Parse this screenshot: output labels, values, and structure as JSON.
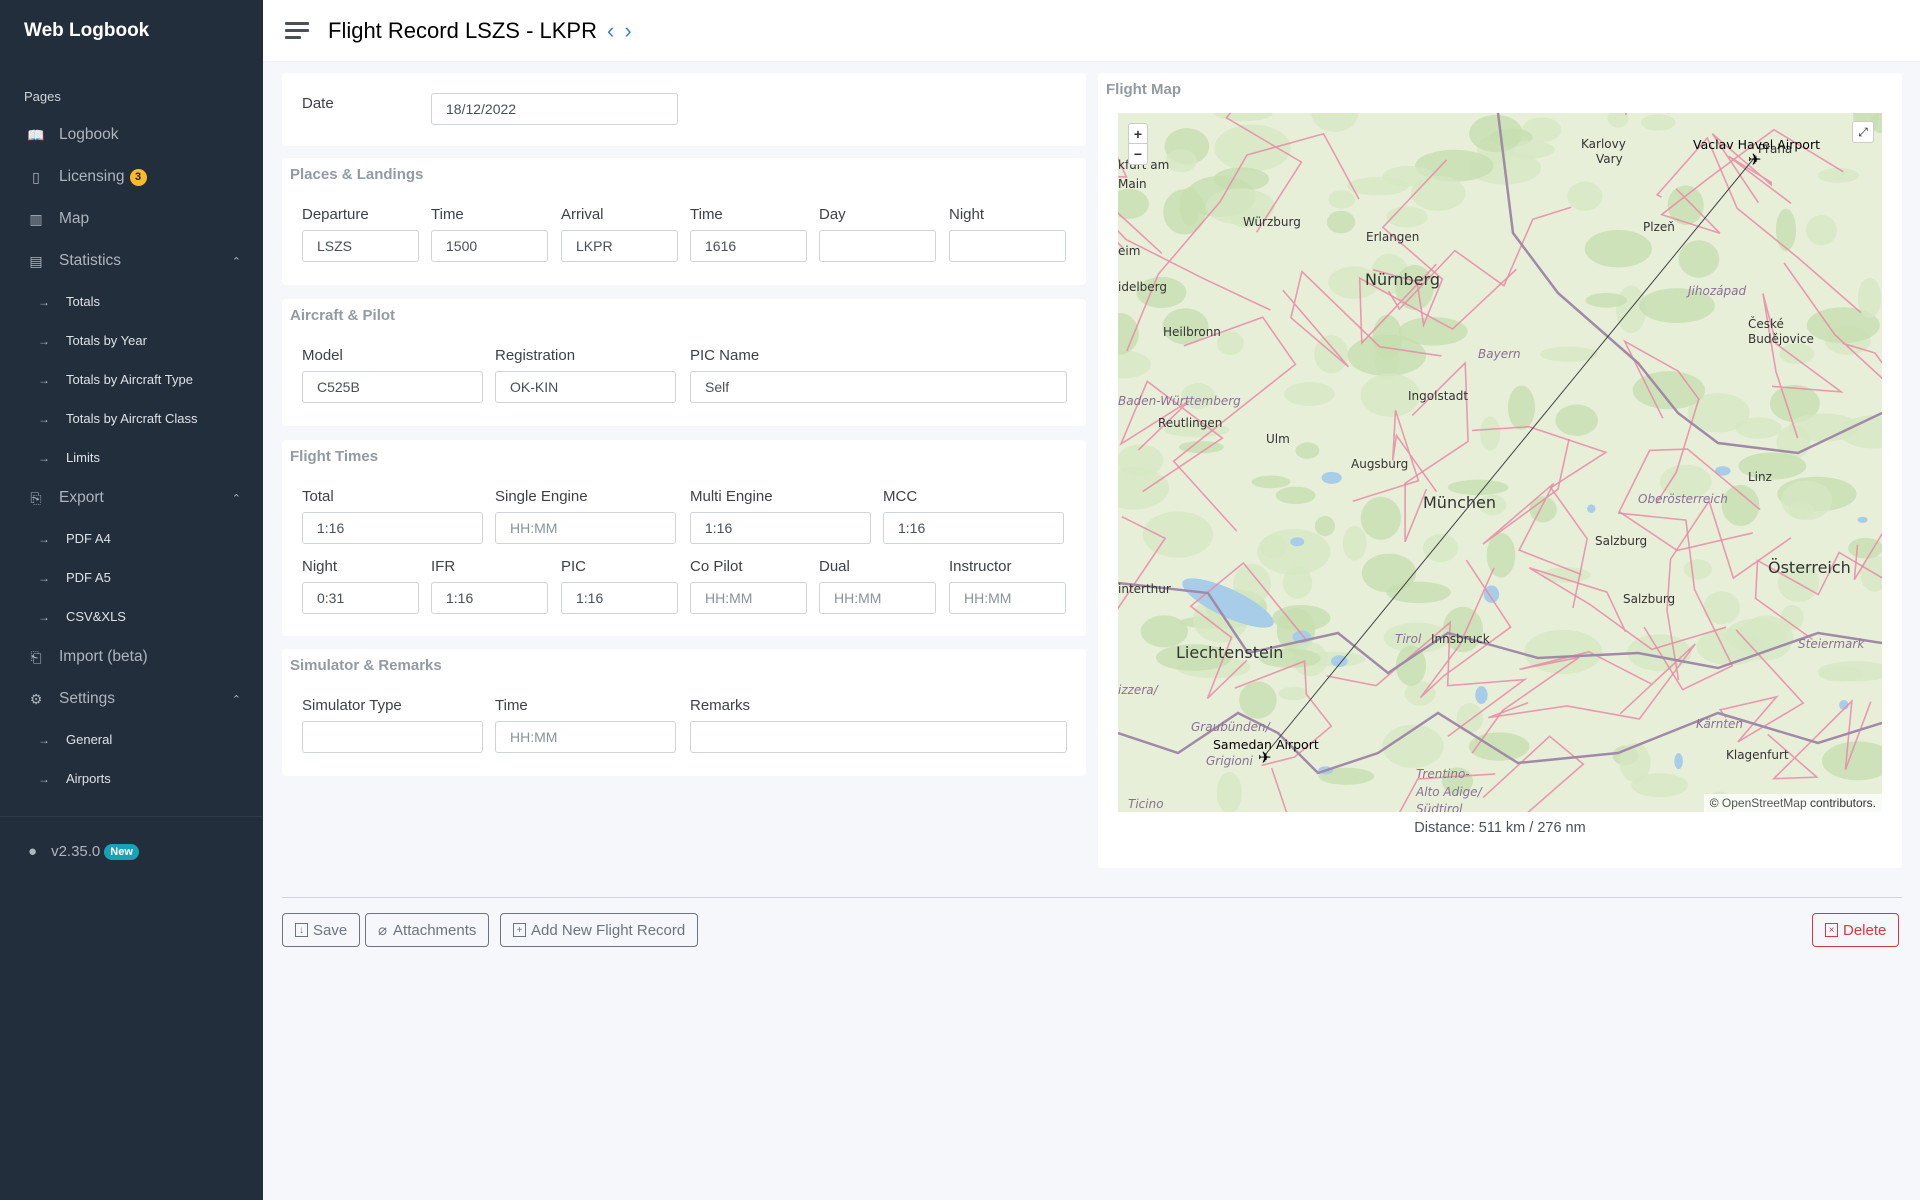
{
  "app": {
    "brand": "Web Logbook",
    "section": "Pages",
    "version": "v2.35.0",
    "version_badge": "New"
  },
  "sidebar": [
    {
      "type": "main",
      "label": "Logbook",
      "icon": "book-icon"
    },
    {
      "type": "main",
      "label": "Licensing",
      "icon": "id-card-icon",
      "badge": "3"
    },
    {
      "type": "main",
      "label": "Map",
      "icon": "map-icon"
    },
    {
      "type": "main",
      "label": "Statistics",
      "icon": "bar-chart-icon",
      "expanded": true
    },
    {
      "type": "sub",
      "label": "Totals"
    },
    {
      "type": "sub",
      "label": "Totals by Year"
    },
    {
      "type": "sub",
      "label": "Totals by Aircraft Type"
    },
    {
      "type": "sub",
      "label": "Totals by Aircraft Class"
    },
    {
      "type": "sub",
      "label": "Limits"
    },
    {
      "type": "main",
      "label": "Export",
      "icon": "file-download-icon",
      "expanded": true
    },
    {
      "type": "sub",
      "label": "PDF A4"
    },
    {
      "type": "sub",
      "label": "PDF A5"
    },
    {
      "type": "sub",
      "label": "CSV&XLS"
    },
    {
      "type": "main",
      "label": "Import (beta)",
      "icon": "file-upload-icon"
    },
    {
      "type": "main",
      "label": "Settings",
      "icon": "gear-icon",
      "expanded": true
    },
    {
      "type": "sub",
      "label": "General"
    },
    {
      "type": "sub",
      "label": "Airports"
    }
  ],
  "header": {
    "title": "Flight Record LSZS - LKPR"
  },
  "date": {
    "label": "Date",
    "value": "18/12/2022"
  },
  "places": {
    "title": "Places & Landings",
    "fields": [
      {
        "label": "Departure",
        "value": "LSZS"
      },
      {
        "label": "Time",
        "value": "1500"
      },
      {
        "label": "Arrival",
        "value": "LKPR"
      },
      {
        "label": "Time",
        "value": "1616"
      },
      {
        "label": "Day",
        "value": ""
      },
      {
        "label": "Night",
        "value": ""
      }
    ]
  },
  "aircraft": {
    "title": "Aircraft & Pilot",
    "fields": [
      {
        "label": "Model",
        "value": "C525B"
      },
      {
        "label": "Registration",
        "value": "OK-KIN"
      },
      {
        "label": "PIC Name",
        "value": "Self"
      }
    ]
  },
  "times": {
    "title": "Flight Times",
    "row1": [
      {
        "label": "Total",
        "value": "1:16"
      },
      {
        "label": "Single Engine",
        "value": "",
        "placeholder": "HH:MM"
      },
      {
        "label": "Multi Engine",
        "value": "1:16"
      },
      {
        "label": "MCC",
        "value": "1:16"
      }
    ],
    "row2": [
      {
        "label": "Night",
        "value": "0:31"
      },
      {
        "label": "IFR",
        "value": "1:16"
      },
      {
        "label": "PIC",
        "value": "1:16"
      },
      {
        "label": "Co Pilot",
        "value": "",
        "placeholder": "HH:MM"
      },
      {
        "label": "Dual",
        "value": "",
        "placeholder": "HH:MM"
      },
      {
        "label": "Instructor",
        "value": "",
        "placeholder": "HH:MM"
      }
    ]
  },
  "simulator": {
    "title": "Simulator & Remarks",
    "fields": [
      {
        "label": "Simulator Type",
        "value": ""
      },
      {
        "label": "Time",
        "value": "",
        "placeholder": "HH:MM"
      },
      {
        "label": "Remarks",
        "value": ""
      }
    ]
  },
  "map": {
    "title": "Flight Map",
    "zoom_in": "+",
    "zoom_out": "−",
    "fullscreen": "⤢",
    "attribution_link": "OpenStreetMap",
    "attribution_rest": "contributors.",
    "attribution_symbol": "©",
    "departure_airport": "Samedan Airport",
    "arrival_airport": "Vaclav Havel Airport",
    "labels": [
      "kfurt am",
      "Main",
      "Würzburg",
      "Erlangen",
      "Nürnberg",
      "Karlovy",
      "Vary",
      "Plzeň",
      "Jihozápad",
      "České",
      "Budějovice",
      "Bayern",
      "Ingolstadt",
      "Baden-Württemberg",
      "Reutlingen",
      "Ulm",
      "Augsburg",
      "München",
      "Linz",
      "Oberösterreich",
      "Salzburg",
      "Österreich",
      "Salzburg",
      "Tirol",
      "Innsbruck",
      "Liechtenstein",
      "Steiermark",
      "Graubünden/",
      "Grigioni",
      "Kärnten",
      "Klagenfurt",
      "Trentino-",
      "Alto Adige/",
      "Südtirol",
      "Ticino",
      "interthur",
      "eim",
      "idelberg",
      "Heilbronn",
      "izzera/",
      "Praha"
    ],
    "distance": "Distance: 511 km / 276 nm"
  },
  "actions": {
    "save": "Save",
    "attachments": "Attachments",
    "add_new": "Add New Flight Record",
    "delete": "Delete"
  },
  "colors": {
    "sidebar": "#222e3c",
    "accent": "#3b7ddd",
    "danger": "#dc3545",
    "badge": "#fcb92c",
    "new_badge": "#17a2b8"
  }
}
